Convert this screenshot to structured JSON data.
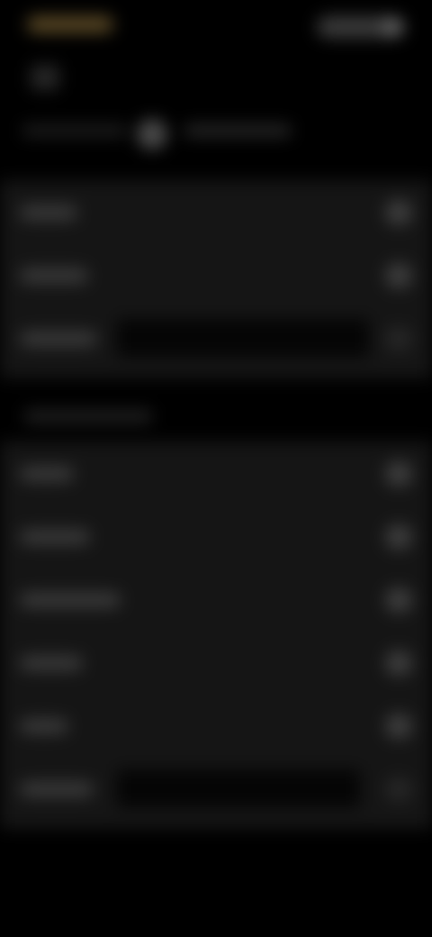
{
  "theme": {
    "background": "#000000",
    "card": "#151515",
    "accent": "#5c4a26"
  },
  "header": {
    "brand_icon": "logo-icon",
    "toggle_icon": "switch-icon",
    "back_icon": "back-arrow-icon"
  },
  "segmented": {
    "icon": "toggle-knob-icon"
  },
  "groups": [
    {
      "rows": [
        {
          "icon": "chevron-right-icon"
        },
        {
          "icon": "chevron-right-icon"
        },
        {
          "icon": "chevron-right-icon"
        }
      ]
    },
    {
      "rows": [
        {
          "icon": "chevron-right-icon"
        },
        {
          "icon": "chevron-right-icon"
        },
        {
          "icon": "chevron-right-icon"
        },
        {
          "icon": "chevron-right-icon"
        },
        {
          "icon": "chevron-right-icon"
        },
        {
          "icon": "chevron-right-icon"
        }
      ]
    }
  ]
}
